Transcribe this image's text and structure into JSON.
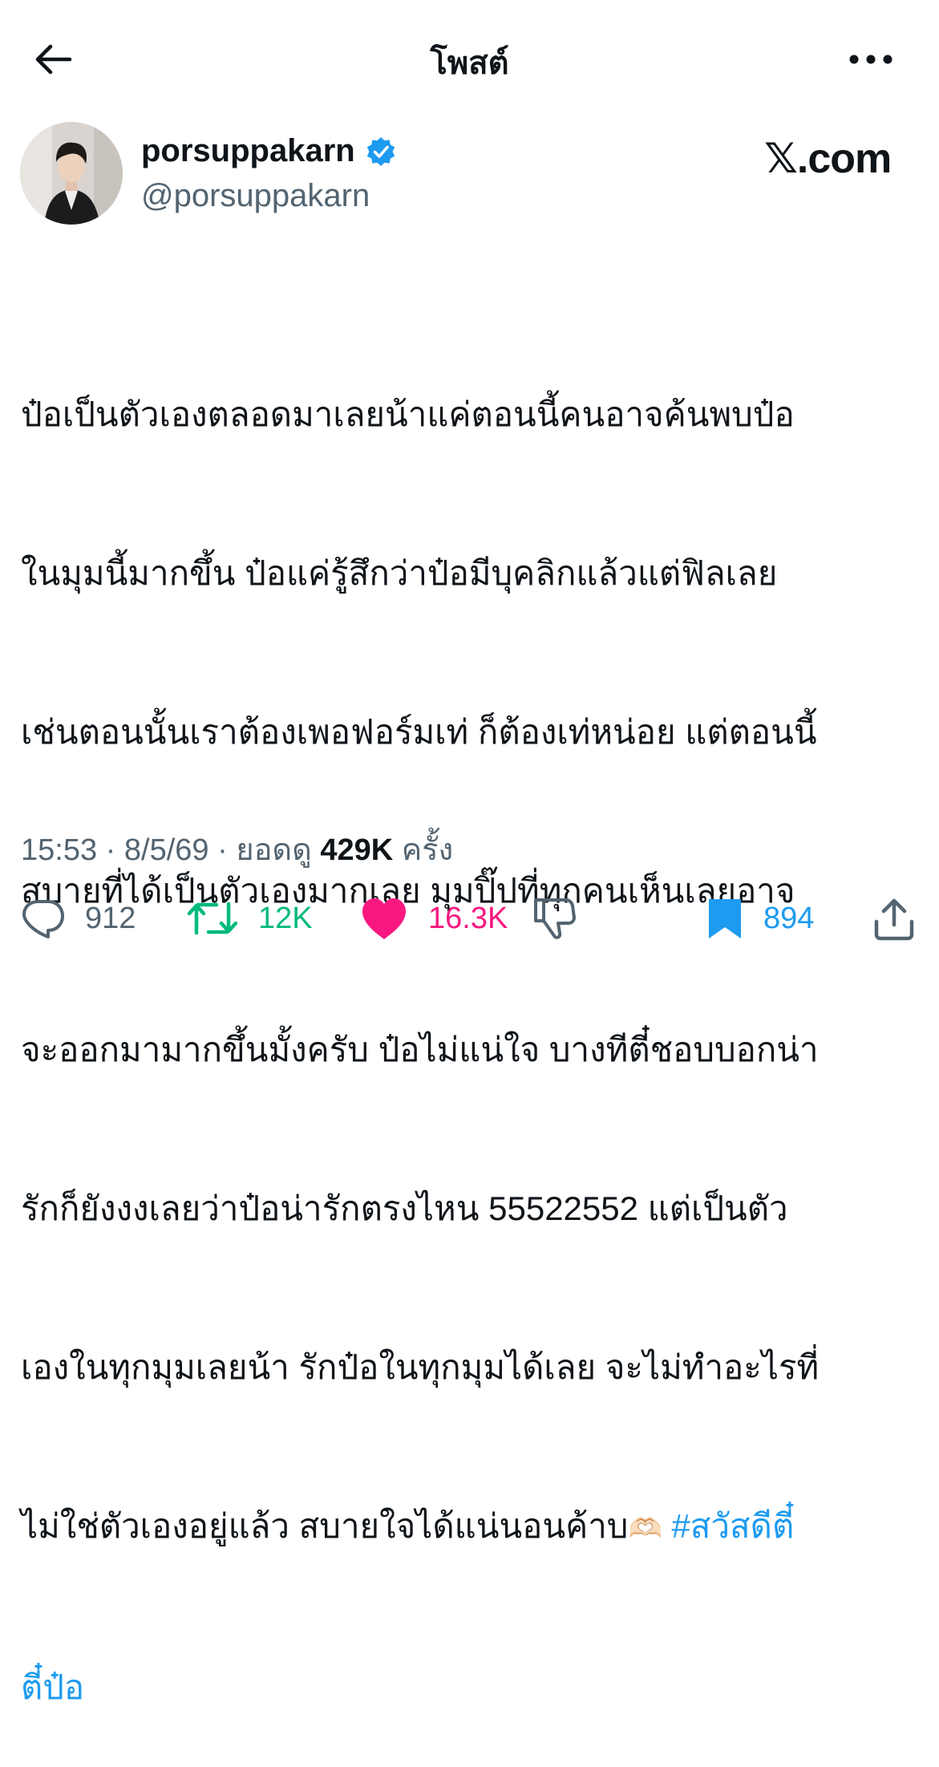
{
  "header": {
    "title": "โพสต์",
    "back_icon": "arrow-left-icon",
    "more_icon": "more-horizontal-icon"
  },
  "author": {
    "display_name": "porsuppakarn",
    "handle": "@porsuppakarn",
    "verified": true,
    "verified_color": "#1d9bf0"
  },
  "watermark": "𝕏.com",
  "post": {
    "lines": [
      "ป๋อเป็นตัวเองตลอดมาเลยน้าแค่ตอนนี้คนอาจค้นพบป๋อ",
      "ในมุมนี้มากขึ้น ป๋อแค่รู้สึกว่าป๋อมีบุคลิกแล้วแต่ฟิลเลย",
      "เช่นตอนนั้นเราต้องเพอฟอร์มเท่ ก็ต้องเท่หน่อย แต่ตอนนี้",
      "สบายที่ได้เป็นตัวเองมากเลย มุมปิ๊ปที่ทุกคนเห็นเลยอาจ",
      "จะออกมามากขึ้นมั้งครับ ป๋อไม่แน่ใจ บางทีตี๋ชอบบอกน่า",
      "รักก็ยังงงเลยว่าป๋อน่ารักตรงไหน 55522552 แต่เป็นตัว",
      "เองในทุกมุมเลยน้า รักป๋อในทุกมุมได้เลย จะไม่ทำอะไรที่"
    ],
    "line8_text": "ไม่ใช่ตัวเองอยู่แล้ว สบายใจได้แน่นอนค้าบ",
    "emoji": "🫶🏻",
    "hashtag_part1": "#สวัสดีตี๋",
    "hashtag_part2": "ตี๋ป๋อ",
    "link_color": "#1d9bf0"
  },
  "meta": {
    "time": "15:53",
    "separator": "·",
    "date": "8/5/69",
    "views_label": "ยอดดู",
    "views_count": "429K",
    "views_suffix": "ครั้ง"
  },
  "actions": {
    "reply": {
      "icon": "reply-icon",
      "count": "912",
      "color": "#536471"
    },
    "repost": {
      "icon": "repost-icon",
      "count": "12K",
      "color": "#00ba7c"
    },
    "like": {
      "icon": "heart-icon",
      "count": "16.3K",
      "color": "#f91880"
    },
    "dislike": {
      "icon": "thumbs-down-icon",
      "color": "#536471"
    },
    "bookmark": {
      "icon": "bookmark-icon",
      "count": "894",
      "color": "#1d9bf0"
    },
    "share": {
      "icon": "share-icon",
      "color": "#536471"
    }
  }
}
